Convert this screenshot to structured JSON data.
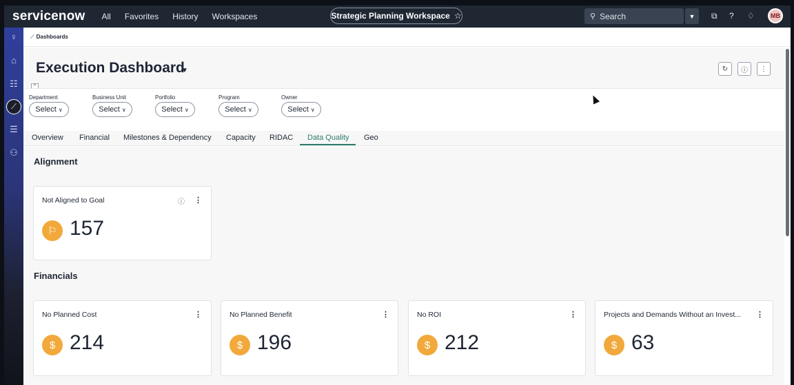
{
  "topbar": {
    "logo": "servicenow",
    "nav": [
      "All",
      "Favorites",
      "History",
      "Workspaces"
    ],
    "workspace": "Strategic Planning Workspace",
    "search_placeholder": "Search",
    "avatar_initials": "MB"
  },
  "breadcrumb": "Dashboards",
  "dashboard": {
    "title": "Execution Dashboard",
    "filters": [
      {
        "label": "Department",
        "value": "Select"
      },
      {
        "label": "Business Unit",
        "value": "Select"
      },
      {
        "label": "Portfolio",
        "value": "Select"
      },
      {
        "label": "Program",
        "value": "Select"
      },
      {
        "label": "Owner",
        "value": "Select"
      }
    ],
    "tabs": [
      "Overview",
      "Financial",
      "Milestones & Dependency",
      "Capacity",
      "RIDAC",
      "Data Quality",
      "Geo"
    ],
    "active_tab": "Data Quality"
  },
  "sections": {
    "alignment": {
      "title": "Alignment",
      "cards": [
        {
          "title": "Not Aligned to Goal",
          "value": "157",
          "icon": "flag-icon"
        }
      ]
    },
    "financials": {
      "title": "Financials",
      "cards": [
        {
          "title": "No Planned Cost",
          "value": "214",
          "icon": "dollar-icon"
        },
        {
          "title": "No Planned Benefit",
          "value": "196",
          "icon": "dollar-icon"
        },
        {
          "title": "No ROI",
          "value": "212",
          "icon": "dollar-icon"
        },
        {
          "title": "Projects and Demands Without an Invest...",
          "value": "63",
          "icon": "dollar-icon"
        }
      ]
    }
  },
  "colors": {
    "accent": "#2e7b6b",
    "badge": "#f2a93b",
    "topbar": "#1f2733",
    "rail": "#2f3f9c"
  }
}
